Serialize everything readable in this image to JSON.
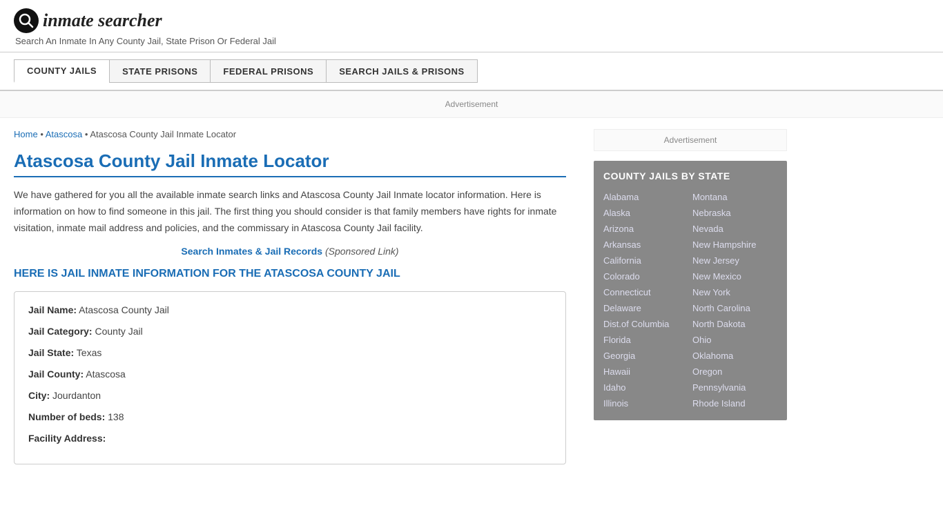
{
  "header": {
    "logo_icon": "🔍",
    "logo_text": "inmate searcher",
    "tagline": "Search An Inmate In Any County Jail, State Prison Or Federal Jail"
  },
  "nav": {
    "items": [
      {
        "label": "COUNTY JAILS",
        "active": true
      },
      {
        "label": "STATE PRISONS",
        "active": false
      },
      {
        "label": "FEDERAL PRISONS",
        "active": false
      },
      {
        "label": "SEARCH JAILS & PRISONS",
        "active": false
      }
    ]
  },
  "ad_top": "Advertisement",
  "breadcrumb": {
    "home": "Home",
    "atascosa": "Atascosa",
    "current": "Atascosa County Jail Inmate Locator"
  },
  "page_title": "Atascosa County Jail Inmate Locator",
  "description": "We have gathered for you all the available inmate search links and Atascosa County Jail Inmate locator information. Here is information on how to find someone in this jail. The first thing you should consider is that family members have rights for inmate visitation, inmate mail address and policies, and the commissary in Atascosa County Jail facility.",
  "sponsored": {
    "link_text": "Search Inmates & Jail Records",
    "label": "(Sponsored Link)"
  },
  "section_heading": "HERE IS JAIL INMATE INFORMATION FOR THE ATASCOSA COUNTY JAIL",
  "info": {
    "jail_name_label": "Jail Name:",
    "jail_name_value": "Atascosa County Jail",
    "jail_category_label": "Jail Category:",
    "jail_category_value": "County Jail",
    "jail_state_label": "Jail State:",
    "jail_state_value": "Texas",
    "jail_county_label": "Jail County:",
    "jail_county_value": "Atascosa",
    "city_label": "City:",
    "city_value": "Jourdanton",
    "beds_label": "Number of beds:",
    "beds_value": "138",
    "address_label": "Facility Address:"
  },
  "sidebar": {
    "ad_label": "Advertisement",
    "state_box_title": "COUNTY JAILS BY STATE",
    "states_col1": [
      "Alabama",
      "Alaska",
      "Arizona",
      "Arkansas",
      "California",
      "Colorado",
      "Connecticut",
      "Delaware",
      "Dist.of Columbia",
      "Florida",
      "Georgia",
      "Hawaii",
      "Idaho",
      "Illinois"
    ],
    "states_col2": [
      "Montana",
      "Nebraska",
      "Nevada",
      "New Hampshire",
      "New Jersey",
      "New Mexico",
      "New York",
      "North Carolina",
      "North Dakota",
      "Ohio",
      "Oklahoma",
      "Oregon",
      "Pennsylvania",
      "Rhode Island"
    ]
  }
}
